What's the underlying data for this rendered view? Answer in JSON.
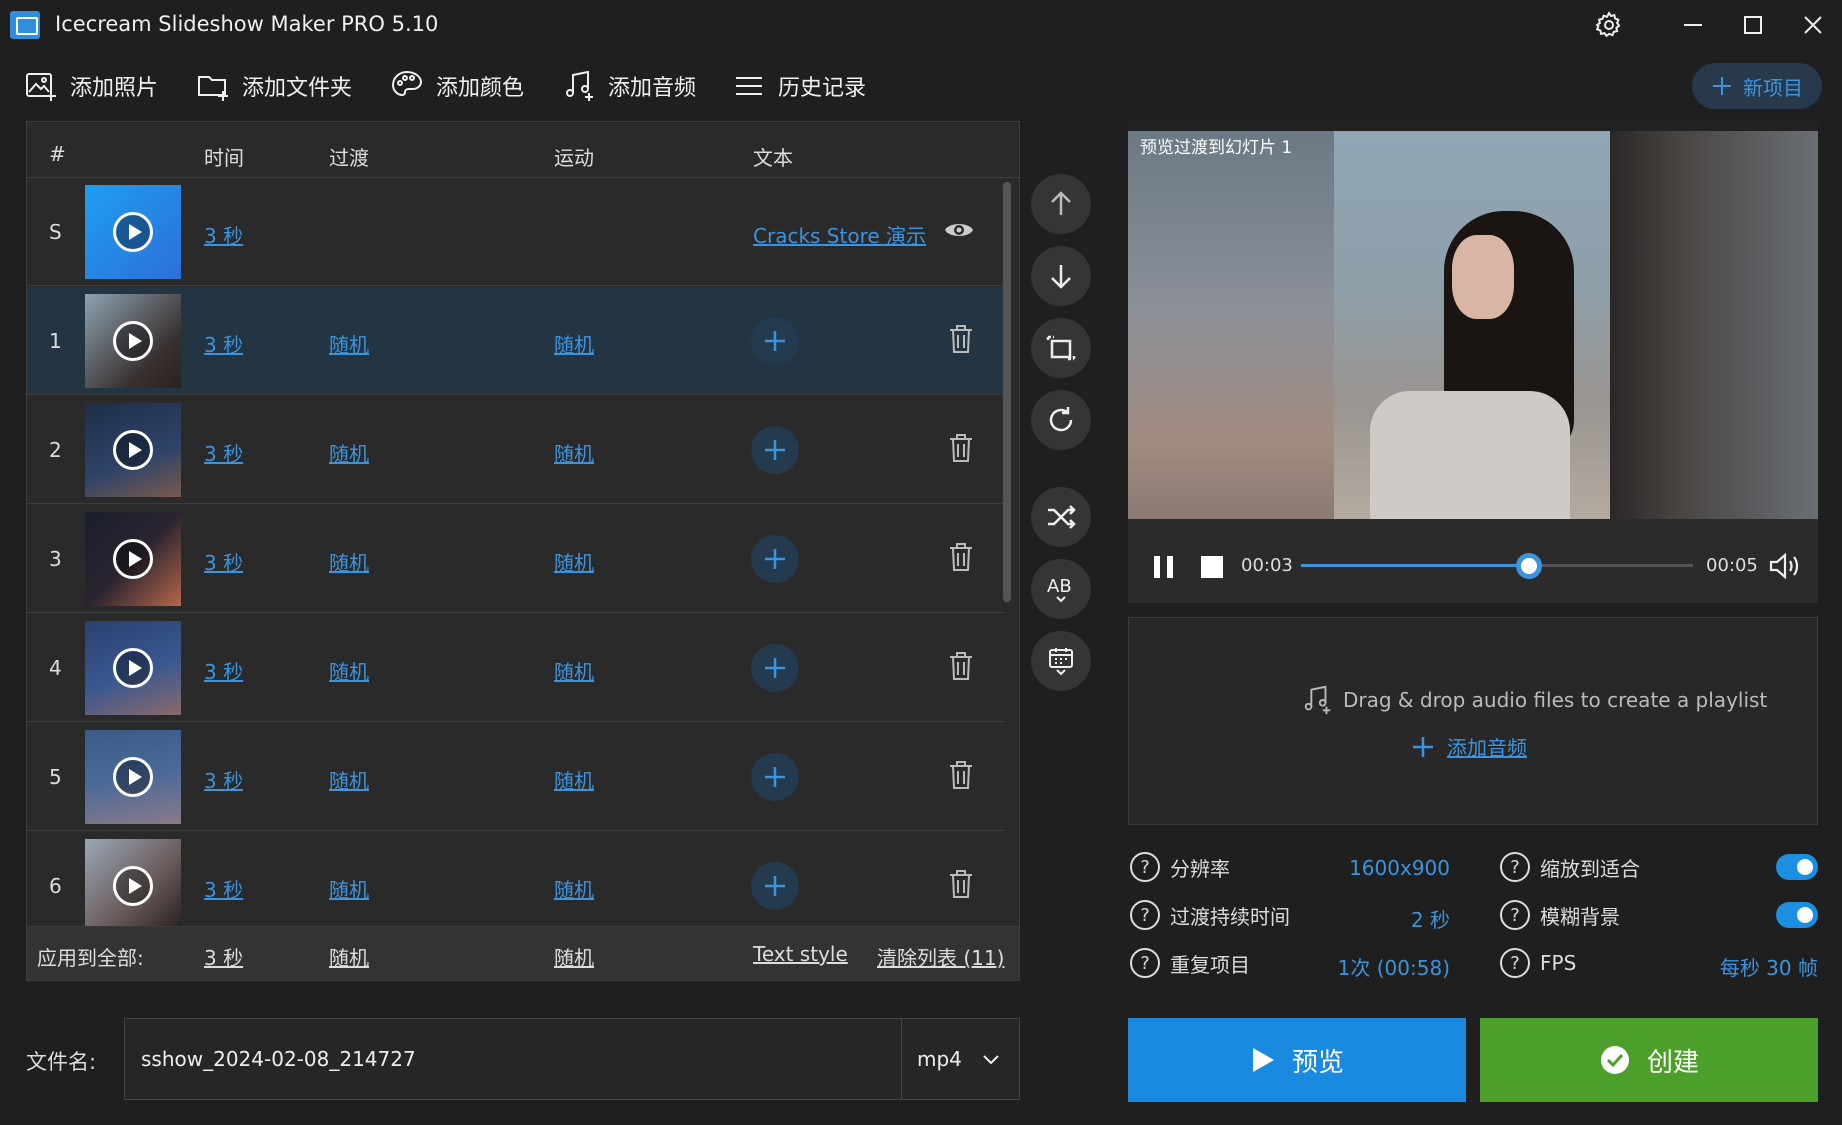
{
  "window": {
    "title": "Icecream Slideshow Maker PRO 5.10"
  },
  "toolbar": {
    "add_photos": "添加照片",
    "add_folder": "添加文件夹",
    "add_color": "添加颜色",
    "add_audio": "添加音频",
    "history": "历史记录",
    "new_project": "新项目"
  },
  "table": {
    "headers": {
      "num": "#",
      "time": "时间",
      "transition": "过渡",
      "motion": "运动",
      "text": "文本"
    },
    "rows": [
      {
        "num": "S",
        "duration": "3 秒",
        "transition": "",
        "motion": "",
        "text": "Cracks Store 演示"
      },
      {
        "num": "1",
        "duration": "3 秒",
        "transition": "随机",
        "motion": "随机"
      },
      {
        "num": "2",
        "duration": "3 秒",
        "transition": "随机",
        "motion": "随机"
      },
      {
        "num": "3",
        "duration": "3 秒",
        "transition": "随机",
        "motion": "随机"
      },
      {
        "num": "4",
        "duration": "3 秒",
        "transition": "随机",
        "motion": "随机"
      },
      {
        "num": "5",
        "duration": "3 秒",
        "transition": "随机",
        "motion": "随机"
      },
      {
        "num": "6",
        "duration": "3 秒",
        "transition": "随机",
        "motion": "随机"
      }
    ],
    "apply_all": {
      "label": "应用到全部:",
      "duration": "3 秒",
      "transition": "随机",
      "motion": "随机",
      "text_style": "Text style",
      "clear_list": "清除列表 (11)"
    }
  },
  "preview": {
    "label": "预览过渡到幻灯片 1",
    "time_current": "00:03",
    "time_total": "00:05",
    "progress": 0.58
  },
  "audio": {
    "drop_text": "Drag & drop audio files to create a playlist",
    "add_audio": "添加音频"
  },
  "settings": {
    "resolution_label": "分辨率",
    "resolution_value": "1600x900",
    "transition_duration_label": "过渡持续时间",
    "transition_duration_value": "2 秒",
    "repeat_label": "重复项目",
    "repeat_value": "1次 (00:58)",
    "fit_label": "缩放到适合",
    "fit_on": true,
    "blur_label": "模糊背景",
    "blur_on": true,
    "fps_label": "FPS",
    "fps_value": "每秒 30 帧"
  },
  "bottom": {
    "filename_label": "文件名:",
    "filename_value": "sshow_2024-02-08_214727",
    "format": "mp4",
    "preview_button": "预览",
    "create_button": "创建"
  },
  "colors": {
    "accent": "#3c94df",
    "create": "#4d9f2c",
    "preview": "#1a8ae0"
  }
}
